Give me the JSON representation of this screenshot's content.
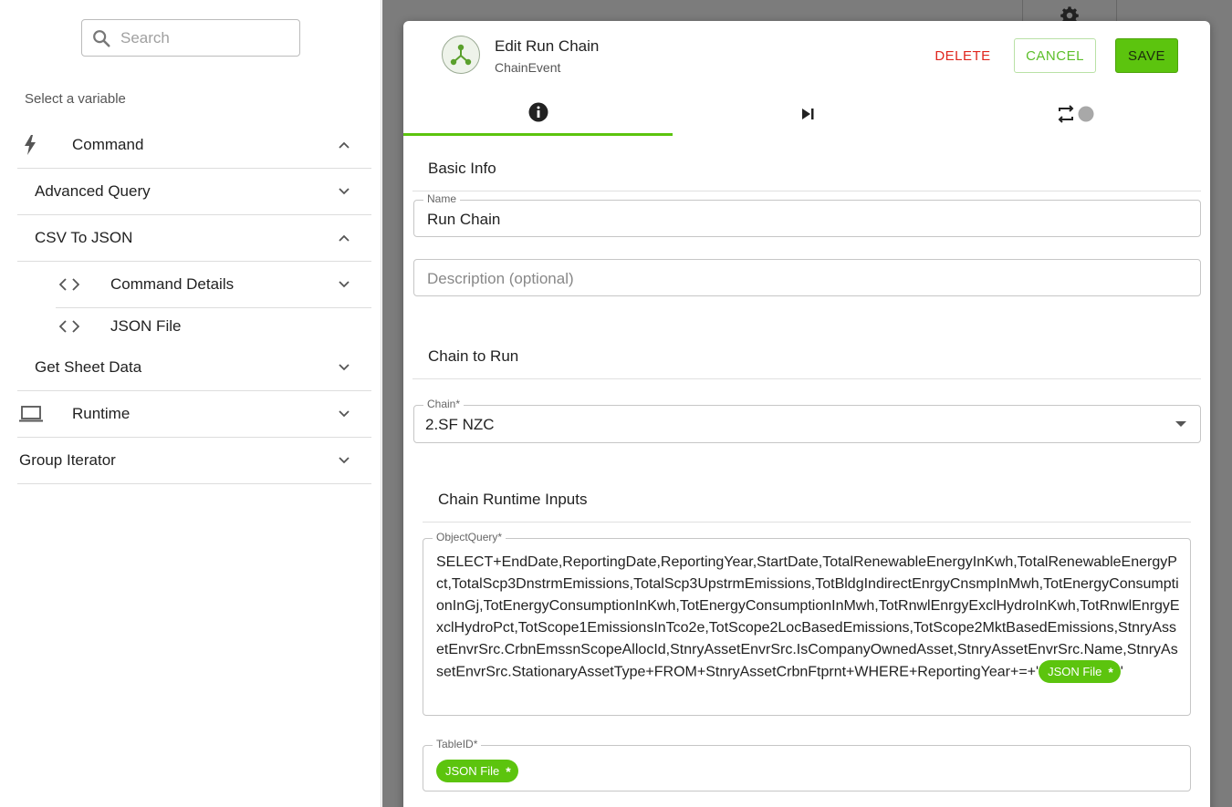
{
  "sidebar": {
    "search_placeholder": "Search",
    "select_label": "Select a variable",
    "items": {
      "command": "Command",
      "advanced_query": "Advanced Query",
      "csv_to_json": "CSV To JSON",
      "command_details": "Command Details",
      "json_file": "JSON File",
      "get_sheet_data": "Get Sheet Data",
      "runtime": "Runtime",
      "group_iterator": "Group Iterator"
    }
  },
  "modal": {
    "title": "Edit Run Chain",
    "subtitle": "ChainEvent",
    "delete_label": "DELETE",
    "cancel_label": "CANCEL",
    "save_label": "SAVE",
    "basic_info_title": "Basic Info",
    "name_label": "Name",
    "name_value": "Run Chain",
    "description_placeholder": "Description (optional)",
    "chain_to_run_title": "Chain to Run",
    "chain_label": "Chain*",
    "chain_value": "2.SF NZC",
    "runtime_inputs_title": "Chain Runtime Inputs",
    "object_query_label": "ObjectQuery*",
    "object_query_text": "SELECT+EndDate,ReportingDate,ReportingYear,StartDate,TotalRenewableEnergyInKwh,TotalRenewableEnergyPct,TotalScp3DnstrmEmissions,TotalScp3UpstrmEmissions,TotBldgIndirectEnrgyCnsmpInMwh,TotEnergyConsumptionInGj,TotEnergyConsumptionInKwh,TotEnergyConsumptionInMwh,TotRnwlEnrgyExclHydroInKwh,TotRnwlEnrgyExclHydroPct,TotScope1EmissionsInTco2e,TotScope2LocBasedEmissions,TotScope2MktBasedEmissions,StnryAssetEnvrSrc.CrbnEmssnScopeAllocId,StnryAssetEnvrSrc.IsCompanyOwnedAsset,StnryAssetEnvrSrc.Name,StnryAssetEnvrSrc.StationaryAssetType+FROM+StnryAssetCrbnFtprnt+WHERE+ReportingYear+=+'",
    "object_query_suffix": "'",
    "object_query_pill": "JSON File",
    "table_id_label": "TableID*",
    "table_id_pill": "JSON File",
    "pill_remove_symbol": "*"
  },
  "colors": {
    "accent_green": "#5cc40e",
    "delete_red": "#e0261e",
    "backdrop_gray": "#7c7c7c"
  },
  "icons": {
    "search": "search-icon",
    "command": "lightning-icon",
    "code": "code-brackets-icon",
    "runtime": "laptop-icon",
    "gear": "gear-icon",
    "chain_logo": "chain-network-icon",
    "tab_info": "info-icon",
    "tab_next": "skip-next-icon",
    "tab_repeat": "repeat-icon"
  }
}
